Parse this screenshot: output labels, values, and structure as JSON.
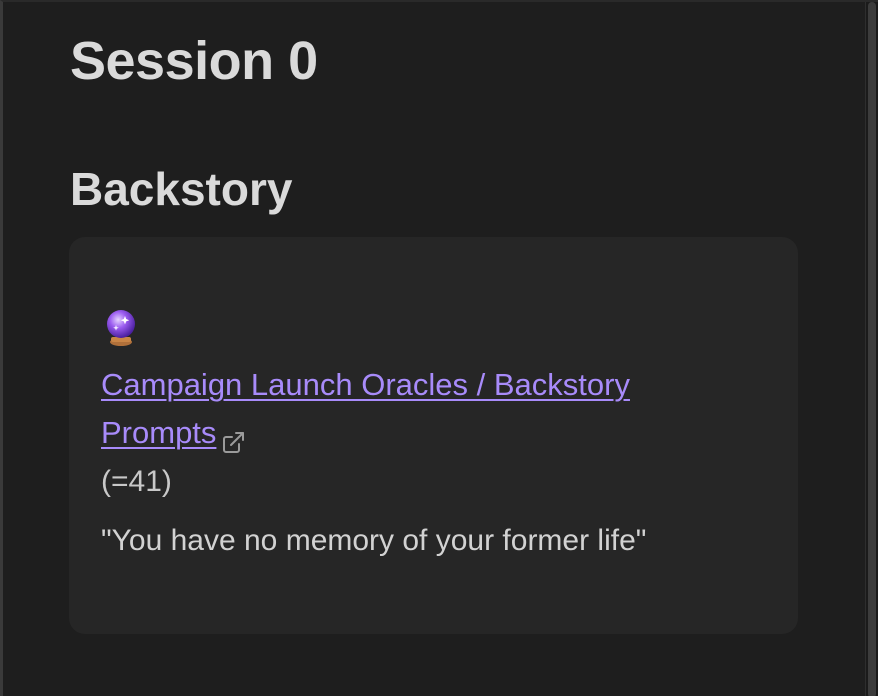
{
  "page": {
    "title": "Session 0"
  },
  "section": {
    "heading": "Backstory"
  },
  "oracle": {
    "icon": "crystal-ball-icon",
    "link_text": "Campaign Launch Oracles / Backstory Prompts",
    "link_icon": "external-link-icon",
    "roll": "(=41)",
    "result": "\"You have no memory of your former life\""
  },
  "colors": {
    "background": "#1e1e1e",
    "callout_background": "#262626",
    "link": "#a88bfa",
    "heading_text": "#dadada"
  }
}
